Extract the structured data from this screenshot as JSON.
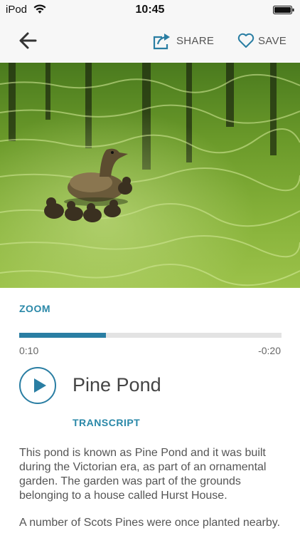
{
  "status_bar": {
    "carrier": "iPod",
    "time": "10:45",
    "icons": [
      "wifi-icon",
      "battery-icon"
    ]
  },
  "nav": {
    "back_icon": "arrow-left-icon",
    "share_label": "SHARE",
    "share_icon": "share-icon",
    "save_label": "SAVE",
    "save_icon": "heart-icon"
  },
  "colors": {
    "accent": "#2a7ea3",
    "link": "#2a88a8",
    "text": "#555555",
    "track": "#e3e3e3"
  },
  "player": {
    "zoom_label": "ZOOM",
    "progress_fraction": 0.33,
    "elapsed": "0:10",
    "remaining": "-0:20",
    "play_icon": "play-icon",
    "title": "Pine Pond",
    "transcript_label": "TRANSCRIPT"
  },
  "transcript": {
    "paragraph_1": "This pond is known as Pine Pond and it was built during the Victorian era, as part of an ornamental garden. The garden was part of the grounds belonging to a house called Hurst House.",
    "paragraph_2": "A number of Scots Pines were once planted nearby."
  }
}
